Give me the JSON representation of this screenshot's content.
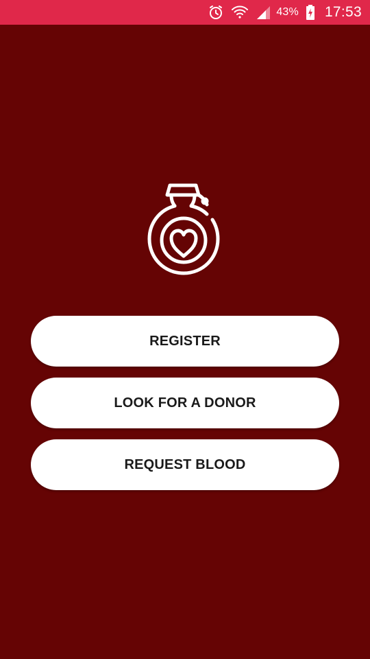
{
  "status_bar": {
    "icons": [
      "alarm-icon",
      "wifi-icon",
      "signal-icon",
      "battery-charging-icon"
    ],
    "battery_percent": "43%",
    "time": "17:53",
    "background_color": "#e0284a"
  },
  "logo": {
    "icon": "blood-bag-heart-icon",
    "color": "#ffffff"
  },
  "actions": {
    "register_label": "REGISTER",
    "look_for_donor_label": "LOOK FOR A DONOR",
    "request_blood_label": "REQUEST BLOOD"
  },
  "theme": {
    "background_color": "#650404",
    "button_color": "#ffffff",
    "button_text_color": "#1a1a1a"
  }
}
